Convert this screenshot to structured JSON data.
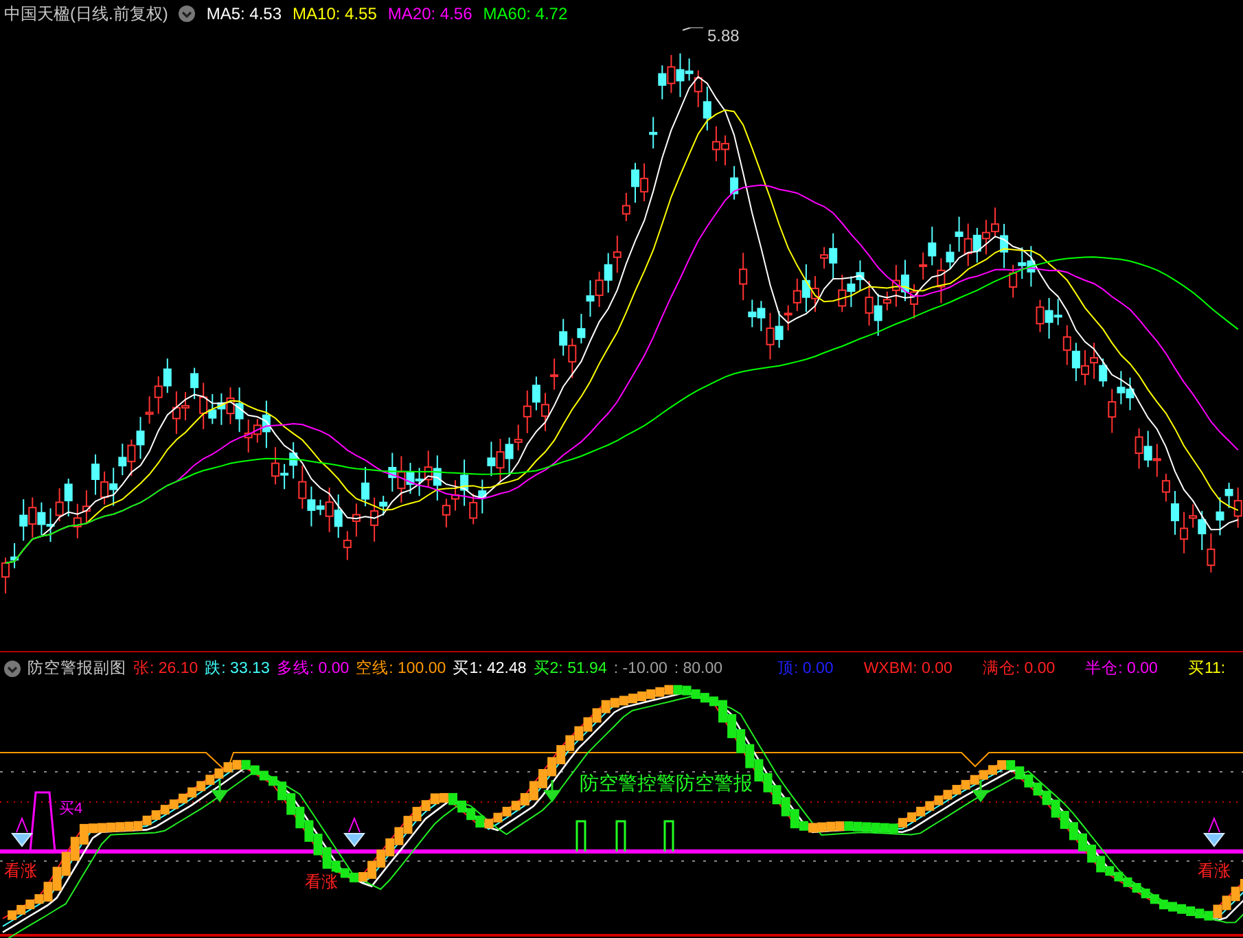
{
  "main_chart": {
    "title": "中国天楹(日线.前复权)",
    "legend": [
      {
        "label": "MA5: 4.53",
        "color": "#ffffff"
      },
      {
        "label": "MA10: 4.55",
        "color": "#ffff00"
      },
      {
        "label": "MA20: 4.56",
        "color": "#ff00ff"
      },
      {
        "label": "MA60: 4.72",
        "color": "#00ff00"
      }
    ],
    "peak_label": "5.88"
  },
  "sub_chart": {
    "title": "防空警报副图",
    "legend": [
      {
        "label": "张: 26.10",
        "color": "#ff2020"
      },
      {
        "label": "跌: 33.13",
        "color": "#40ffff"
      },
      {
        "label": "多线: 0.00",
        "color": "#ff00ff"
      },
      {
        "label": "空线: 100.00",
        "color": "#ff9900"
      },
      {
        "label": "买1: 42.48",
        "color": "#ffffff"
      },
      {
        "label": "买2: 51.94",
        "color": "#22ff22"
      },
      {
        "label": ": -10.00",
        "color": "#a0a0a0"
      },
      {
        "label": ": 80.00",
        "color": "#a0a0a0"
      },
      {
        "label": "顶: 0.00",
        "color": "#2020ff"
      },
      {
        "label": "WXBM: 0.00",
        "color": "#ff2020"
      },
      {
        "label": "满仓: 0.00",
        "color": "#ff2020"
      },
      {
        "label": "半仓: 0.00",
        "color": "#ff00ff"
      },
      {
        "label": "买11:",
        "color": "#ffff00"
      }
    ],
    "alert_text": "防空警控警防空警报",
    "buy_label": "买4",
    "signal_labels": [
      "看涨",
      "看涨",
      "看涨"
    ]
  }
}
